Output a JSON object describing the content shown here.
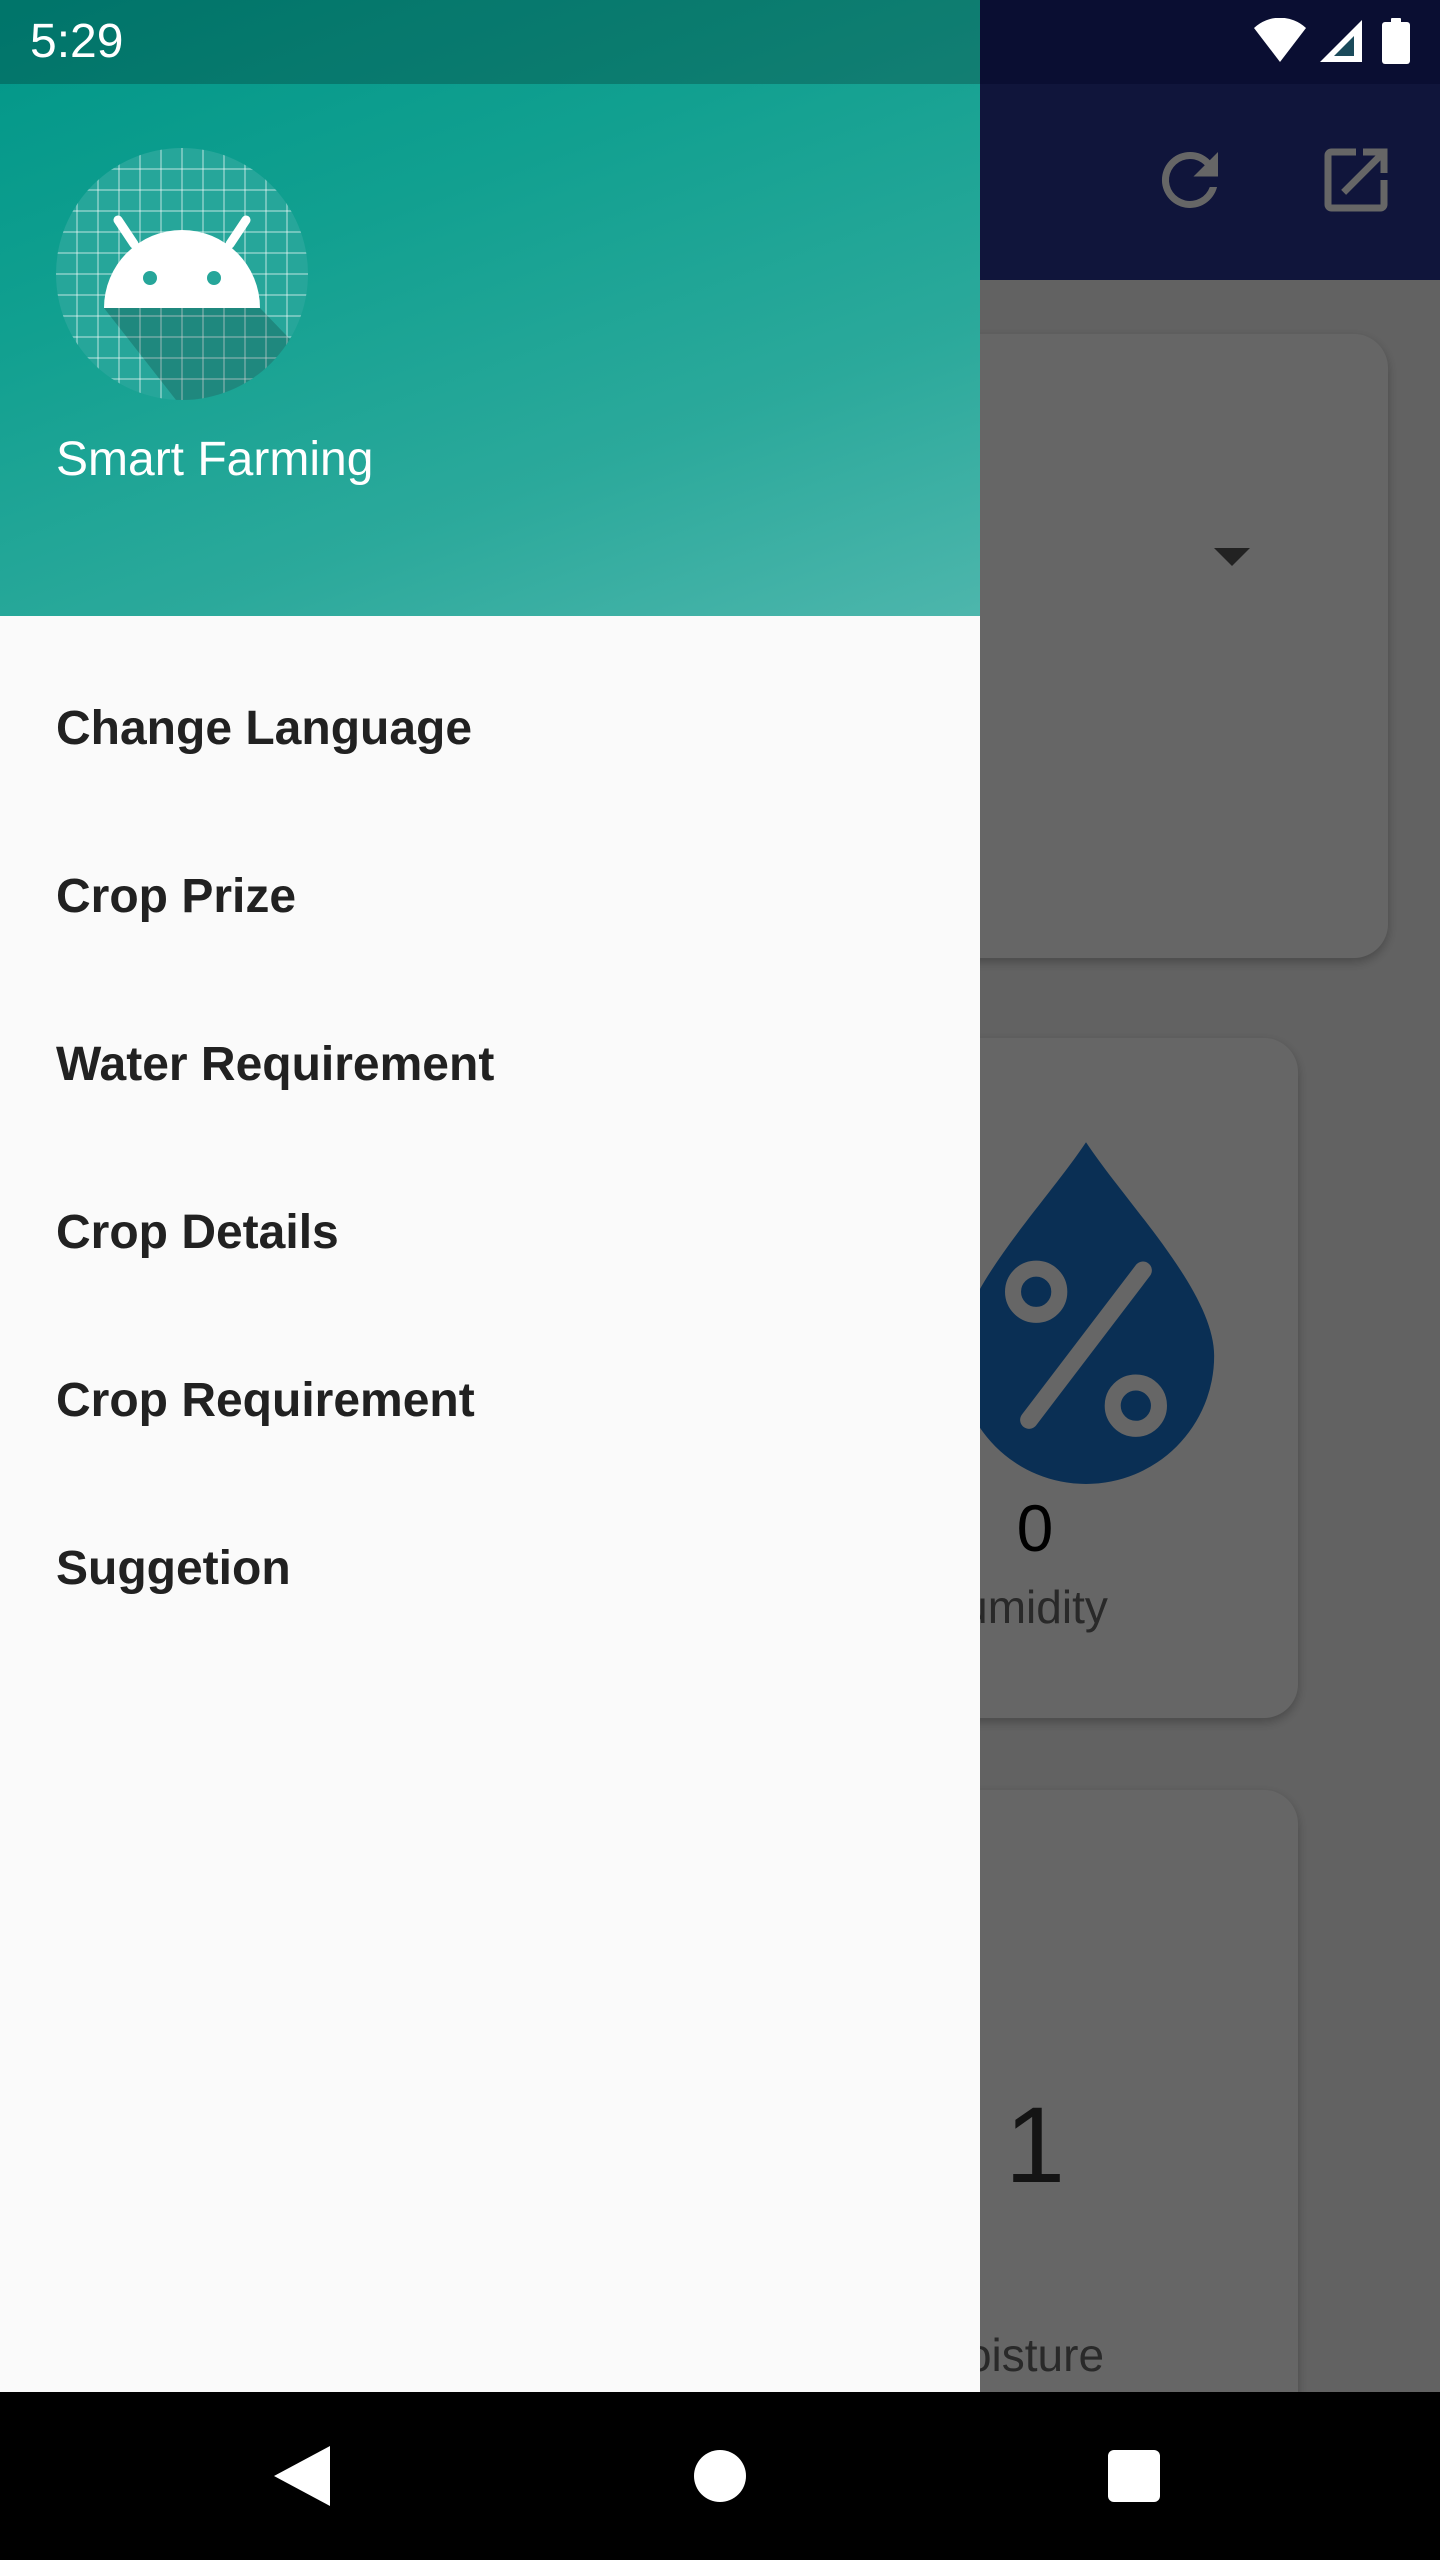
{
  "status_bar": {
    "time": "5:29",
    "icons": [
      "wifi-icon",
      "cell-signal-icon",
      "battery-icon"
    ]
  },
  "app_background": {
    "toolbar_icons": [
      "refresh-icon",
      "open-external-icon"
    ],
    "humidity_card": {
      "value": "0",
      "label": "umidity"
    },
    "moisture_card": {
      "value": "1",
      "label": "oisture"
    }
  },
  "drawer": {
    "header": {
      "app_name": "Smart Farming",
      "logo_icon": "android-icon"
    },
    "items": [
      {
        "label": "Change Language"
      },
      {
        "label": "Crop Prize"
      },
      {
        "label": "Water Requirement"
      },
      {
        "label": "Crop Details"
      },
      {
        "label": "Crop Requirement"
      },
      {
        "label": "Suggetion"
      }
    ]
  },
  "nav_bar": {
    "buttons": [
      "back-icon",
      "home-icon",
      "recents-icon"
    ]
  },
  "colors": {
    "drawer_header_start": "#009688",
    "drawer_header_end": "#4db6ac",
    "toolbar": "#283593",
    "humidity_drop": "#1976d2"
  }
}
